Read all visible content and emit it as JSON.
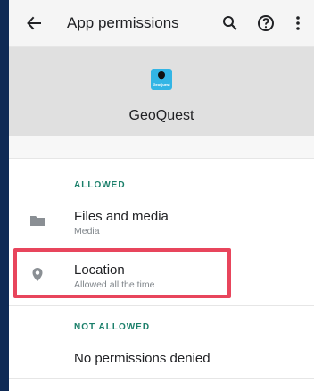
{
  "app_bar": {
    "title": "App permissions",
    "back_icon": "arrow-back-icon",
    "search_icon": "search-icon",
    "help_icon": "help-icon",
    "more_icon": "more-vert-icon"
  },
  "app": {
    "name": "GeoQuest",
    "icon_text": "GeoQuest",
    "icon_color": "#33b5e5"
  },
  "sections": {
    "allowed_label": "ALLOWED",
    "not_allowed_label": "NOT ALLOWED"
  },
  "permissions_allowed": [
    {
      "title": "Files and media",
      "subtitle": "Media",
      "icon": "folder-icon"
    },
    {
      "title": "Location",
      "subtitle": "Allowed all the time",
      "icon": "location-pin-icon"
    }
  ],
  "permissions_not_allowed": {
    "text": "No permissions denied"
  },
  "colors": {
    "accent": "#1a7f6a",
    "highlight": "#e8455c",
    "page_bg": "#0f2a55"
  }
}
